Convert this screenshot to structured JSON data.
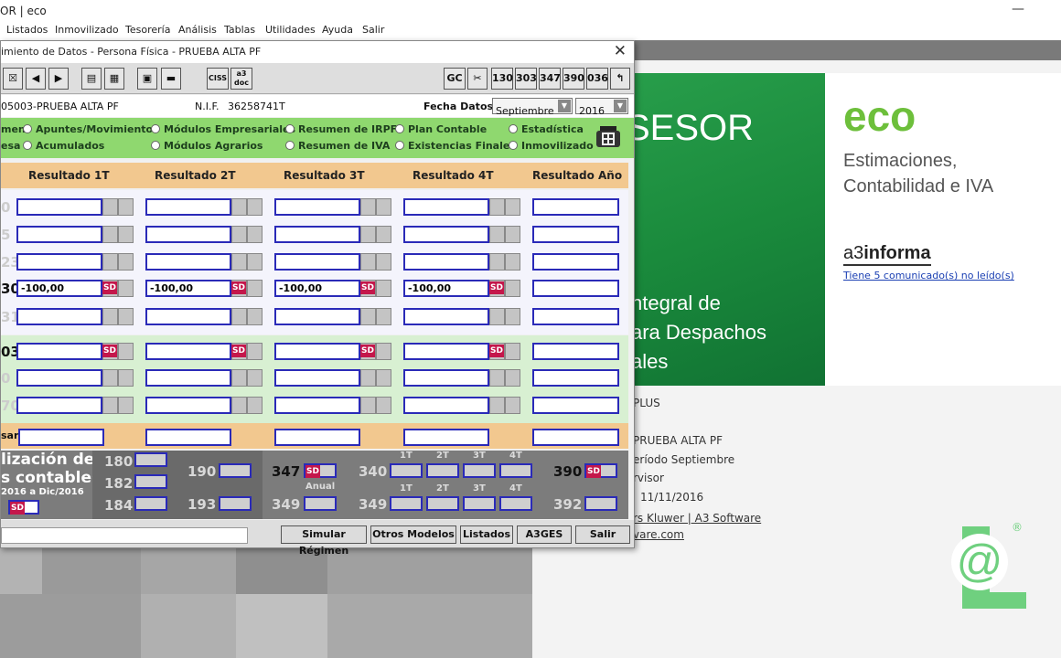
{
  "window": {
    "title": "OR | eco"
  },
  "menu": [
    "Listados",
    "Inmovilizado",
    "Tesorería",
    "Análisis",
    "Tablas",
    "Utilidades",
    "Ayuda",
    "Salir"
  ],
  "splash": {
    "brand": "SESOR",
    "product": "eco",
    "tagline": [
      "Estimaciones,",
      "Contabilidad e IVA"
    ],
    "integral": [
      "ntegral de",
      "ara Despachos",
      "ales"
    ],
    "a3_prefix": "a3",
    "a3_suffix": "informa",
    "comunicados": "Tiene 5 comunicado(s) no leído(s)",
    "plus": "PLUS",
    "empresa": "PRUEBA ALTA PF",
    "periodo": "eríodo  Septiembre",
    "usuario": "rvisor",
    "fecha": "11/11/2016",
    "company": "rs Kluwer | A3 Software",
    "web": "vare.com",
    "logo_mark": "@",
    "logo_reg": "®"
  },
  "dialog": {
    "title": "imiento de Datos - Persona Física - PRUEBA ALTA PF",
    "close": "✕",
    "toolbar": {
      "close_doc": "☒",
      "prev": "◀",
      "next": "▶",
      "print": "▤",
      "preview": "▦",
      "calc": "▣",
      "minus": "▬",
      "ciss": "CISS",
      "a3doc": "a3 doc",
      "gc": "GC",
      "tools": "✂",
      "m130": "130",
      "m303": "303",
      "m347": "347",
      "m390": "390",
      "m036": "036",
      "back": "↰"
    },
    "header": {
      "empresa": "05003-PRUEBA ALTA PF",
      "nif_label": "N.I.F.",
      "nif": "36258741T",
      "fecha_label": "Fecha Datos",
      "mes": "Septiembre",
      "anio": "2016"
    },
    "options": [
      "men",
      "Apuntes/Movimientos",
      "Módulos Empresariales",
      "Resumen de IRPF",
      "Plan Contable",
      "Estadística",
      "esa",
      "Acumulados",
      "Módulos Agrarios",
      "Resumen de IVA",
      "Existencias Finales",
      "Inmovilizado"
    ],
    "columns": [
      "Resultado 1T",
      "Resultado 2T",
      "Resultado 3T",
      "Resultado 4T",
      "Resultado Año"
    ],
    "row_labels": [
      "0",
      "5",
      "23",
      "30",
      "31",
      "03",
      "0",
      "70",
      "sar"
    ],
    "value_m100": "-100,00",
    "sd": "SD",
    "bottom": {
      "title1": "lización de",
      "title2": "s contables",
      "title3": "2016 a Dic/2016",
      "m180": "180",
      "m182": "182",
      "m184": "184",
      "m190": "190",
      "m193": "193",
      "m347": "347",
      "anual": "Anual",
      "m349a": "349",
      "m340": "340",
      "m349b": "349",
      "q1": "1T",
      "q2": "2T",
      "q3": "3T",
      "q4": "4T",
      "m390": "390",
      "m392": "392"
    },
    "footer": {
      "simular": "Simular Régimen",
      "otros": "Otros Modelos",
      "listados": "Listados",
      "a3ges": "A3GES",
      "salir": "Salir"
    }
  }
}
